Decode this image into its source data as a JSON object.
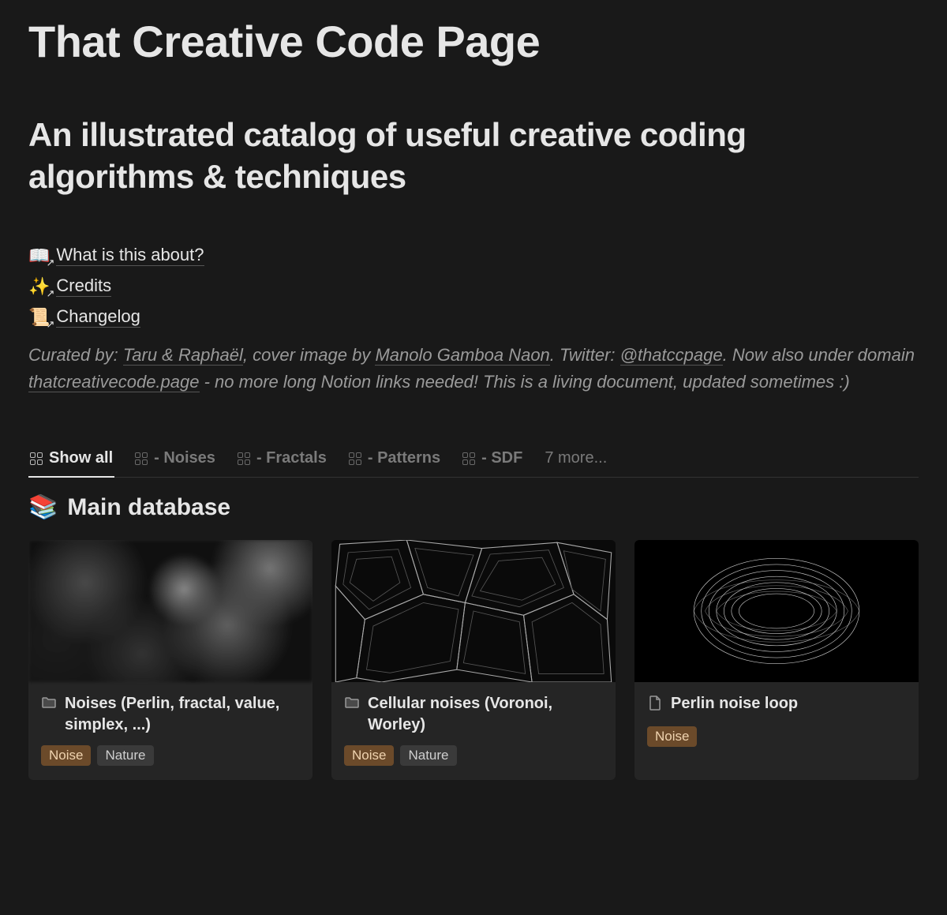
{
  "title": "That Creative Code Page",
  "subtitle": "An illustrated catalog of useful creative coding algorithms & techniques",
  "nav_links": [
    {
      "emoji": "📖",
      "label": "What is this about?"
    },
    {
      "emoji": "✨",
      "label": "Credits"
    },
    {
      "emoji": "📜",
      "label": "Changelog"
    }
  ],
  "credits": {
    "prefix": "Curated by: ",
    "curators": "Taru & Raphaël",
    "mid1": ", cover image by ",
    "cover_author": "Manolo Gamboa Naon",
    "mid2": ". Twitter: ",
    "twitter": "@thatccpage",
    "mid3": ". Now also under domain ",
    "domain": "thatcreativecode.page",
    "mid4": " - no more long Notion links needed! This is a living document, updated sometimes :)"
  },
  "tabs": [
    {
      "label": "Show all",
      "active": true
    },
    {
      "label": "- Noises",
      "active": false
    },
    {
      "label": "- Fractals",
      "active": false
    },
    {
      "label": "- Patterns",
      "active": false
    },
    {
      "label": "- SDF",
      "active": false
    }
  ],
  "more_tabs": "7 more...",
  "database": {
    "emoji": "📚",
    "title": "Main database"
  },
  "cards": [
    {
      "icon": "folder",
      "title": "Noises (Perlin, fractal, value, simplex, ...)",
      "tags": [
        {
          "label": "Noise",
          "kind": "noise"
        },
        {
          "label": "Nature",
          "kind": "nature"
        }
      ]
    },
    {
      "icon": "folder",
      "title": "Cellular noises (Voronoi, Worley)",
      "tags": [
        {
          "label": "Noise",
          "kind": "noise"
        },
        {
          "label": "Nature",
          "kind": "nature"
        }
      ]
    },
    {
      "icon": "page",
      "title": "Perlin noise loop",
      "tags": [
        {
          "label": "Noise",
          "kind": "noise"
        }
      ]
    }
  ]
}
